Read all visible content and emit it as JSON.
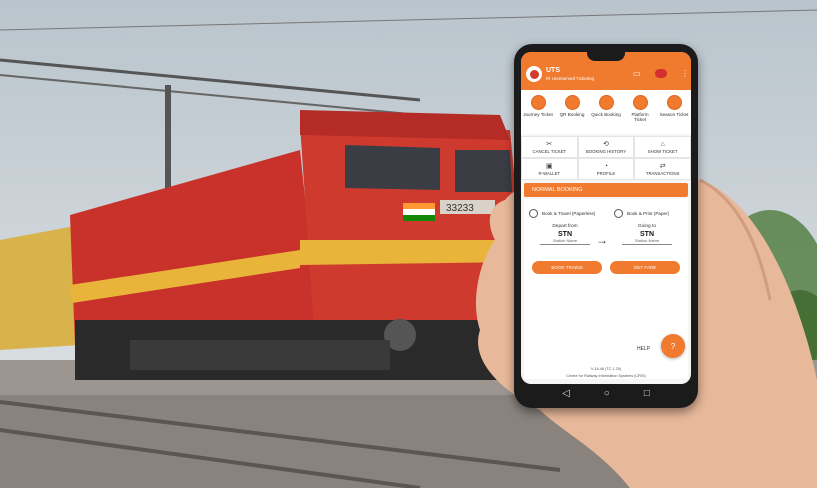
{
  "app": {
    "title": "UTS",
    "subtitle": "IR Unreserved Ticketing"
  },
  "appbar_icons": [
    "cast-icon",
    "notification-icon",
    "more-icon"
  ],
  "tiles": [
    {
      "label": "Journey Ticket",
      "icon": "journey-icon"
    },
    {
      "label": "QR Booking",
      "icon": "qr-icon"
    },
    {
      "label": "Quick Booking",
      "icon": "quick-icon"
    },
    {
      "label": "Platform Ticket",
      "icon": "platform-icon"
    },
    {
      "label": "Season Ticket",
      "icon": "season-icon"
    }
  ],
  "grid": [
    {
      "label": "CANCEL TICKET",
      "icon": "✂"
    },
    {
      "label": "BOOKING HISTORY",
      "icon": "⟲"
    },
    {
      "label": "SHOW TICKET",
      "icon": "⌂"
    },
    {
      "label": "R-WALLET",
      "icon": "▣"
    },
    {
      "label": "PROFILE",
      "icon": "◔"
    },
    {
      "label": "TRANSACTIONS",
      "icon": "⇄"
    }
  ],
  "booking": {
    "section_label": "NORMAL BOOKING",
    "option1": "Book & Travel (Paperless)",
    "option2": "Book & Print (Paper)",
    "depart_label": "Depart from",
    "depart_code": "STN",
    "depart_name": "Station Name",
    "going_label": "Going to",
    "going_code": "STN",
    "going_name": "Station Name",
    "btn1": "BOOK TRAINS",
    "btn2": "GET FARE"
  },
  "help_label": "HELP",
  "version": "V-16.46 (TC 1.20)",
  "footer": "Centre for Railway Information Systems (CRIS)",
  "train": {
    "number": "33233"
  },
  "colors": {
    "accent": "#f07a2e",
    "loco_red": "#c8322b",
    "loco_yellow": "#e9b43a"
  }
}
